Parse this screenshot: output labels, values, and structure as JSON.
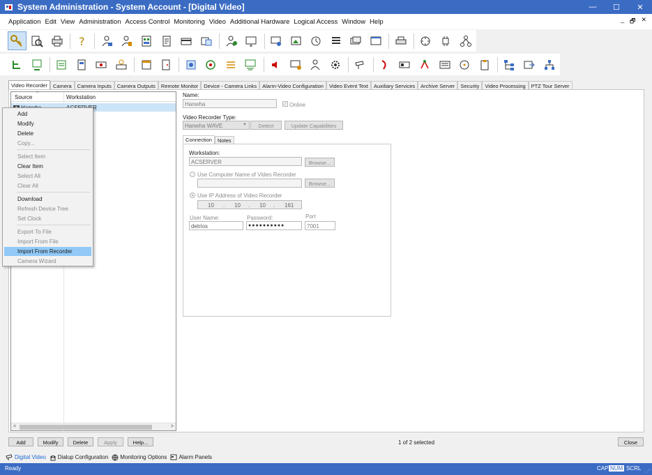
{
  "window": {
    "title": "System Administration - System Account - [Digital Video]",
    "min": "—",
    "max": "☐",
    "close": "✕"
  },
  "menu": {
    "items": [
      "Application",
      "Edit",
      "View",
      "Administration",
      "Access Control",
      "Monitoring",
      "Video",
      "Additional Hardware",
      "Logical Access",
      "Window",
      "Help"
    ],
    "mdi": [
      "_",
      "🗗",
      "✕"
    ]
  },
  "tabs": [
    "Video Recorder",
    "Camera",
    "Camera Inputs",
    "Camera Outputs",
    "Remote Monitor",
    "Device - Camera Links",
    "Alarm-Video Configuration",
    "Video Event Text",
    "Auxiliary Services",
    "Archive Server",
    "Security",
    "Video Processing",
    "PTZ Tour Server"
  ],
  "tree": {
    "col_source": "Source",
    "col_workstation": "Workstation",
    "rows": [
      {
        "source": "Hanwha",
        "workstation": "ACSERVER"
      }
    ],
    "scroll_left": "<",
    "scroll_right": ">"
  },
  "context_menu": {
    "items": [
      {
        "label": "Add",
        "enabled": true
      },
      {
        "label": "Modify",
        "enabled": true
      },
      {
        "label": "Delete",
        "enabled": true
      },
      {
        "label": "Copy...",
        "enabled": false
      },
      {
        "label": "Select Item",
        "enabled": false
      },
      {
        "label": "Clear Item",
        "enabled": true
      },
      {
        "label": "Select All",
        "enabled": false
      },
      {
        "label": "Clear All",
        "enabled": false
      },
      {
        "label": "Download",
        "enabled": true
      },
      {
        "label": "Refresh Device Tree",
        "enabled": false
      },
      {
        "label": "Set Clock",
        "enabled": false
      },
      {
        "label": "Export To File",
        "enabled": false
      },
      {
        "label": "Import From File",
        "enabled": false
      },
      {
        "label": "Import From Recorder",
        "enabled": true,
        "highlighted": true
      },
      {
        "label": "Camera Wizard",
        "enabled": false
      }
    ]
  },
  "form": {
    "name_label": "Name:",
    "name_value": "Hanwha",
    "online_label": "Online",
    "online_mark": "✓",
    "type_label": "Video Recorder Type:",
    "type_value": "Hanwha WAVE",
    "select_arrow": "▼",
    "detect_label": "Detect",
    "update_label": "Update Capabilities",
    "subtabs": [
      "Connection",
      "Notes"
    ],
    "workstation_label": "Workstation:",
    "workstation_value": "ACSERVER",
    "browse_label": "Browse...",
    "use_computer_name_label": "Use Computer Name of Video Recorder",
    "computer_name_value": "",
    "use_ip_label": "Use IP Address of Video Recorder",
    "ip": [
      "10",
      "10",
      "10",
      "161"
    ],
    "ip_dot": ".",
    "username_label": "User Name:",
    "username_value": "detrios",
    "password_label": "Password:",
    "password_value": "●●●●●●●●●●",
    "port_label": "Port",
    "port_value": "7001"
  },
  "bottom": {
    "add": "Add",
    "modify": "Modify",
    "delete": "Delete",
    "apply": "Apply",
    "help": "Help...",
    "selected_count": "1 of 2 selected",
    "close": "Close"
  },
  "nav": [
    "Digital Video",
    "Dialup Configuration",
    "Monitoring Options",
    "Alarm Panels"
  ],
  "status": {
    "text": "Ready",
    "cap": "CAP",
    "num": "NUM",
    "scrl": "SCRL"
  },
  "colors": {
    "titlebar": "#3b6cc4",
    "selection": "#cce4f7",
    "menu_highlight": "#91c9f7",
    "nav_active": "#1e6ad2"
  }
}
